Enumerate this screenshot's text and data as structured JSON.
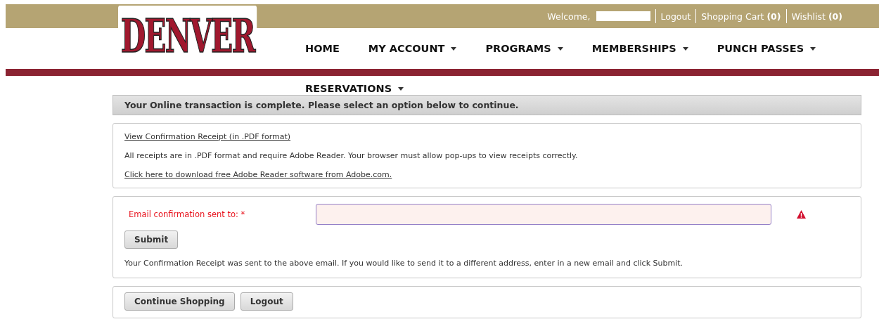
{
  "logo": {
    "text": "DENVER"
  },
  "top_bar": {
    "welcome": "Welcome,",
    "links": [
      {
        "label": "Logout"
      },
      {
        "label": "Shopping Cart",
        "count": "(0)"
      },
      {
        "label": "Wishlist",
        "count": "(0)"
      }
    ]
  },
  "nav": {
    "rows": [
      [
        {
          "label": "HOME",
          "dropdown": false
        },
        {
          "label": "MY ACCOUNT",
          "dropdown": true
        },
        {
          "label": "PROGRAMS",
          "dropdown": true
        },
        {
          "label": "MEMBERSHIPS",
          "dropdown": true
        },
        {
          "label": "PUNCH PASSES",
          "dropdown": true
        }
      ],
      [
        {
          "label": "RESERVATIONS",
          "dropdown": true
        }
      ]
    ]
  },
  "banner": "Your Online transaction is complete. Please select an option below to continue.",
  "receipt_panel": {
    "link": "View Confirmation Receipt (in .PDF format)",
    "note": "All receipts are in .PDF format and require Adobe Reader. Your browser must allow pop-ups to view receipts correctly.",
    "download_link": "Click here to download free Adobe Reader software from Adobe.com."
  },
  "email_panel": {
    "label": "Email confirmation sent to: *",
    "error": true,
    "submit": "Submit",
    "note": "Your Confirmation Receipt was sent to the above email. If you would like to send it to a different address, enter in a new email and click Submit."
  },
  "buttons": [
    "Continue Shopping",
    "Logout"
  ]
}
